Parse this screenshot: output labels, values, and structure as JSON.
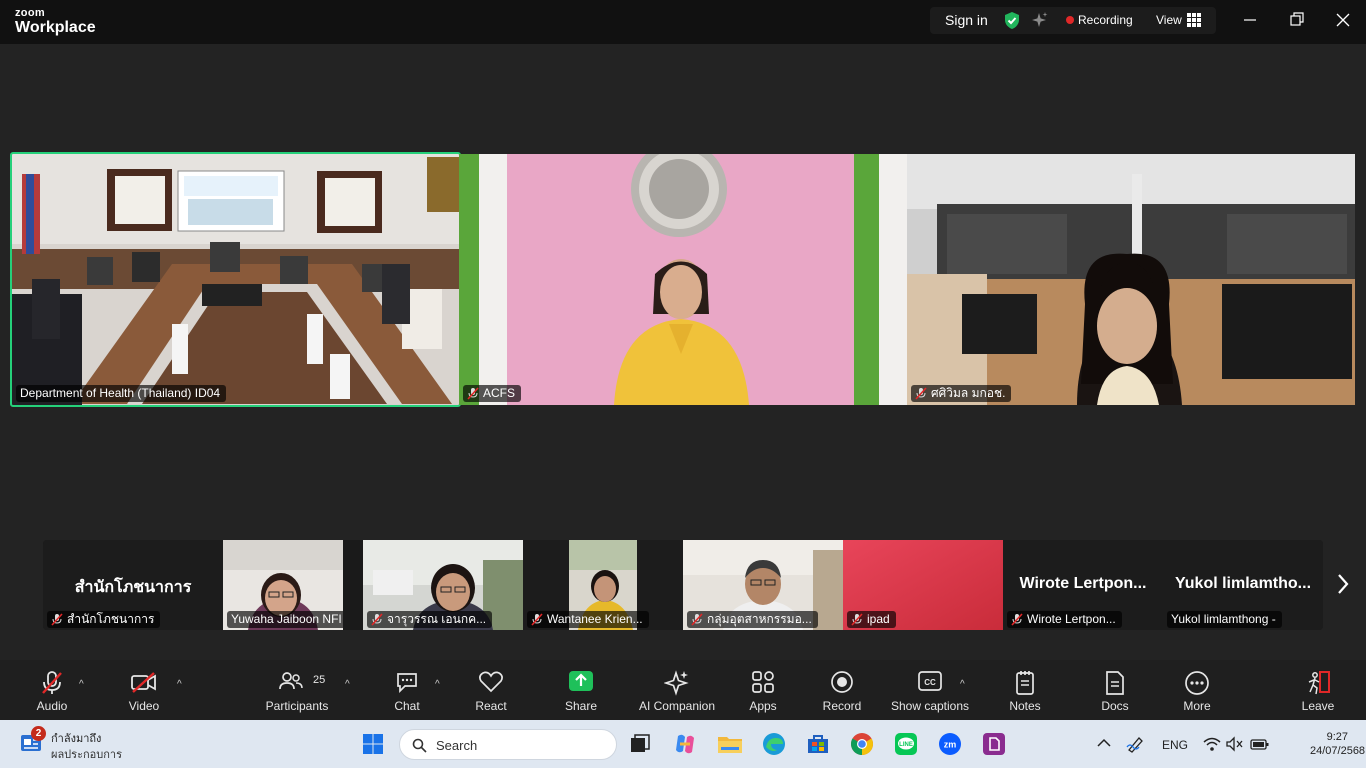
{
  "titlebar": {
    "logo_line1": "zoom",
    "logo_line2": "Workplace",
    "sign_in": "Sign in",
    "recording": "Recording",
    "view": "View",
    "icons": [
      "shield-check-icon",
      "sparkle-icon",
      "grid-view-icon",
      "minimize-icon",
      "restore-icon",
      "close-icon"
    ]
  },
  "main_tiles": [
    {
      "name": "Department of Health (Thailand) ID04",
      "muted": false,
      "active_speaker": true
    },
    {
      "name": "ACFS",
      "muted": true,
      "active_speaker": false
    },
    {
      "name": "ศศิวิมล มกอช.",
      "muted": true,
      "active_speaker": false
    }
  ],
  "strip_tiles": [
    {
      "display_name": "สำนักโภชนาการ",
      "name": "สำนักโภชนาการ",
      "muted": true,
      "video": false
    },
    {
      "name": "Yuwaha Jaiboon NFI",
      "muted": false,
      "video": true
    },
    {
      "name": "จารุวรรณ เอนกค...",
      "muted": true,
      "video": true
    },
    {
      "name": "Wantanee Krien...",
      "muted": true,
      "video": true
    },
    {
      "name": "กลุ่มอุตสาหกรรมอ...",
      "muted": true,
      "video": true
    },
    {
      "name": "ipad",
      "muted": true,
      "video": true
    },
    {
      "display_name": "Wirote  Lertpon...",
      "name": "Wirote Lertpon...",
      "muted": true,
      "video": false
    },
    {
      "display_name": "Yukol  limlamtho...",
      "name": "Yukol limlamthong -",
      "muted": false,
      "video": false
    }
  ],
  "toolbar": {
    "audio": "Audio",
    "video": "Video",
    "participants": "Participants",
    "participants_count": "25",
    "chat": "Chat",
    "react": "React",
    "share": "Share",
    "ai_companion": "AI Companion",
    "apps": "Apps",
    "record": "Record",
    "show_captions": "Show captions",
    "notes": "Notes",
    "docs": "Docs",
    "more": "More",
    "leave": "Leave",
    "share_color": "#1fc05a",
    "leave_color": "#e02828"
  },
  "taskbar": {
    "news_badge": "2",
    "news_line1": "กำลังมาถึง",
    "news_line2": "ผลประกอบการ",
    "search_placeholder": "Search",
    "language": "ENG",
    "time": "9:27",
    "date": "24/07/2568",
    "apps": [
      "start-icon",
      "task-view-icon",
      "copilot-icon",
      "file-explorer-icon",
      "edge-icon",
      "store-icon",
      "chrome-icon",
      "line-icon",
      "zoom-icon",
      "pdf-icon"
    ]
  }
}
